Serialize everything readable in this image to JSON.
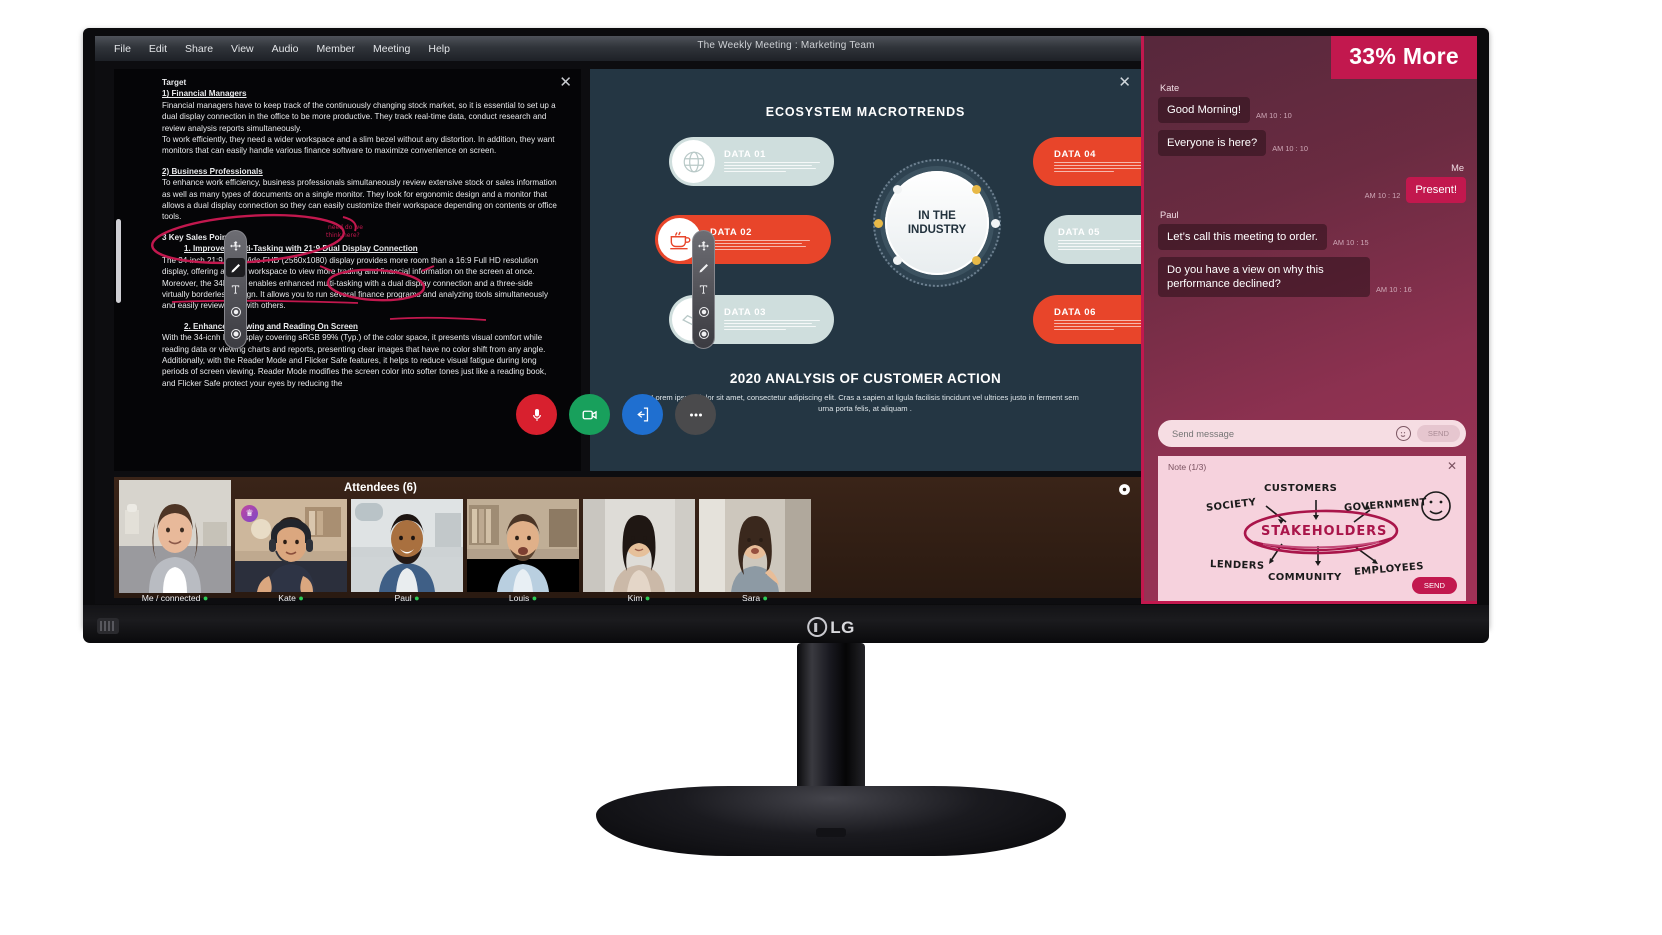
{
  "window": {
    "title": "The Weekly Meeting : Marketing Team",
    "menu": [
      "File",
      "Edit",
      "Share",
      "View",
      "Audio",
      "Member",
      "Meeting",
      "Help"
    ]
  },
  "document_pane": {
    "close_label": "✕",
    "heading": "Target",
    "section1_title": "1) Financial Managers",
    "section1_body": "Financial managers have to keep track of the continuously changing stock market, so it is essential to set up a dual display connection in the office to be more productive. They track real-time data, conduct research and review analysis reports simultaneously.",
    "section1_body2": "To work efficiently, they need a wider workspace and a slim bezel without any distortion. In addition, they want monitors that can easily handle various finance software to maximize convenience on screen.",
    "section2_title": "2) Business Professionals",
    "section2_body": "To enhance work efficiency, business professionals simultaneously review extensive stock or sales information as well as many types of documents on a single monitor. They look for ergonomic design and a monitor that allows a dual display connection so they can easily customize their workspace depending on contents or office tools.",
    "sales_heading": "3 Key Sales Points",
    "point1_title": "1.   Improved Multi-Tasking with 21:9 Dual Display Connection",
    "point1_body": "The 34-inch 21:9 UltraWide FHD (2560x1080) display provides more room than a 16:9 Full HD resolution display, offering a wider workspace to view more trading and financial information on the screen at once. Moreover, the 34BL650 enables enhanced multi-tasking with a dual display connection and a three-side virtually borderless design. It allows you to run several finance programs and analyzing tools simultaneously and easily review data with others.",
    "point2_title": "2.   Enhanced Viewing and Reading On Screen",
    "point2_body": "With the 34-icnh IPS display covering sRGB 99% (Typ.) of the color space, it presents visual comfort while reading data or viewing charts and reports, presenting clear images that have no color shift from any angle.",
    "point2_body2": "Additionally, with the Reader Mode and Flicker Safe features, it helps to reduce visual fatigue during long periods of screen viewing. Reader Mode modifies the screen color into softer tones just like a reading book, and Flicker Safe protect your eyes by reducing the"
  },
  "toolbar": {
    "items": [
      {
        "icon": "move-icon",
        "active": false
      },
      {
        "icon": "pen-icon",
        "active": true
      },
      {
        "icon": "text-icon",
        "active": false
      },
      {
        "icon": "record-icon",
        "active": false
      },
      {
        "icon": "stop-icon",
        "active": false
      }
    ]
  },
  "slide_pane": {
    "close_label": "✕",
    "title": "ECOSYSTEM MACROTRENDS",
    "center_line1": "IN THE",
    "center_line2": "INDUSTRY",
    "subtitle": "2020 ANALYSIS OF CUSTOMER ACTION",
    "body": "Lorem ipsum dolor sit amet, consectetur adipiscing elit. Cras a sapien at ligula facilisis tincidunt vel ultrices justo in ferment sem urna porta felis, at aliquam .",
    "bubbles": [
      {
        "label": "DATA 01",
        "icon": "globe-icon",
        "color": "#cfdedd",
        "style": "mint"
      },
      {
        "label": "DATA 02",
        "icon": "coffee-icon",
        "color": "#e8452a",
        "style": "red"
      },
      {
        "label": "DATA 03",
        "icon": "handshake-icon",
        "color": "#cfdedd",
        "style": "mint"
      },
      {
        "label": "DATA 04",
        "icon": "piggy-bank-icon",
        "color": "#e8452a",
        "style": "red"
      },
      {
        "label": "DATA 05",
        "icon": "megaphone-icon",
        "color": "#cfdedd",
        "style": "mint"
      },
      {
        "label": "DATA 06",
        "icon": "growth-chart-icon",
        "color": "#e8452a",
        "style": "red"
      }
    ]
  },
  "call_controls": [
    {
      "name": "microphone",
      "icon": "mic-icon",
      "color": "#d8202e"
    },
    {
      "name": "camera",
      "icon": "camera-icon",
      "color": "#18a05c"
    },
    {
      "name": "share-screen",
      "icon": "share-icon",
      "color": "#1f6fd0"
    },
    {
      "name": "more-options",
      "icon": "ellipsis-icon",
      "color": "#4a4a4c"
    }
  ],
  "attendees": {
    "title": "Attendees (6)",
    "gear_icon": "gear-icon",
    "list": [
      {
        "name": "Me / connected",
        "status": "connected",
        "host": false
      },
      {
        "name": "Kate",
        "status": "online",
        "host": true
      },
      {
        "name": "Paul",
        "status": "online",
        "host": false
      },
      {
        "name": "Louis",
        "status": "online",
        "host": false
      },
      {
        "name": "Kim",
        "status": "online",
        "host": false
      },
      {
        "name": "Sara",
        "status": "online",
        "host": false
      }
    ]
  },
  "chat": {
    "badge": "33% More",
    "messages": [
      {
        "sender": "Kate",
        "text": "Good Morning!",
        "time": "AM 10 : 10",
        "mine": false,
        "show_sender": true
      },
      {
        "sender": "Kate",
        "text": "Everyone is here?",
        "time": "AM 10 : 10",
        "mine": false,
        "show_sender": false
      },
      {
        "sender": "Me",
        "text": "Present!",
        "time": "AM 10 : 12",
        "mine": true,
        "show_sender": true
      },
      {
        "sender": "Paul",
        "text": "Let’s call this meeting to order.",
        "time": "AM 10 : 15",
        "mine": false,
        "show_sender": true
      },
      {
        "sender": "Paul",
        "text": "Do you have a view on why this performance  declined?",
        "time": "AM 10 : 16",
        "mine": false,
        "show_sender": false
      }
    ],
    "input_placeholder": "Send message",
    "input_value": "",
    "emoji_icon": "smiley-icon",
    "send_label": "SEND"
  },
  "note": {
    "title": "Note (1/3)",
    "close_label": "✕",
    "send_label": "SEND",
    "center_word": "STAKEHOLDERS",
    "nodes": [
      "SOCIETY",
      "CUSTOMERS",
      "GOVERNMENT",
      "LENDERS",
      "COMMUNITY",
      "EMPLOYEES"
    ],
    "smiley": "smiley-face-icon"
  },
  "monitor": {
    "brand": "LG",
    "joystick_icon": "joystick-icon"
  },
  "colors": {
    "accent": "#c2184e",
    "slide_bg": "#243643",
    "slide_red": "#e8452a",
    "slide_mint": "#cfdedd",
    "online": "#2ecb55"
  }
}
